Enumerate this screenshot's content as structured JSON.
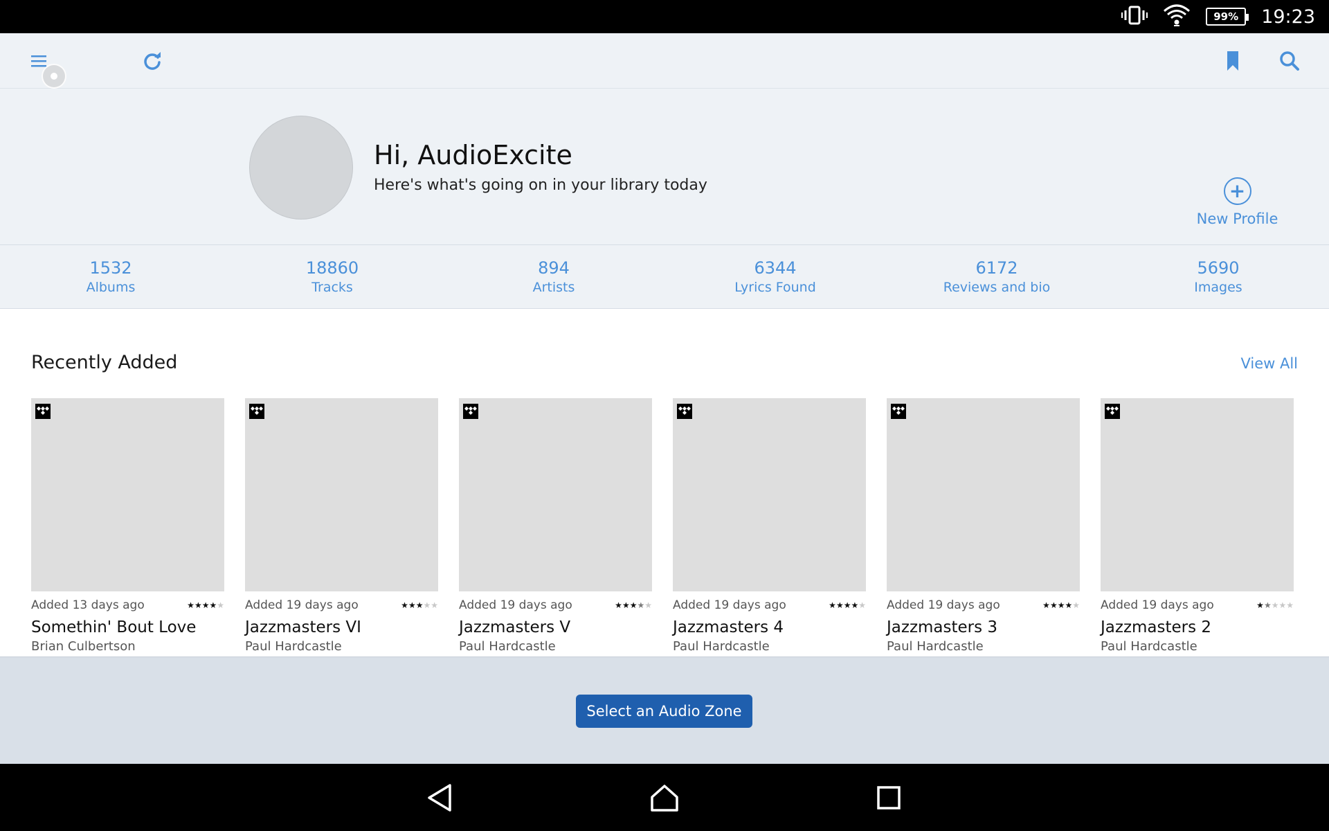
{
  "status_bar": {
    "battery": "99%",
    "time": "19:23"
  },
  "toolbar": {
    "icons": [
      "menu-icon",
      "refresh-icon",
      "bookmark-icon",
      "search-icon"
    ]
  },
  "profile": {
    "greeting": "Hi, AudioExcite",
    "subtitle": "Here's what's going on in your library today",
    "new_profile_label": "New Profile",
    "new_profile_icon": "+"
  },
  "stats": [
    {
      "value": "1532",
      "label": "Albums"
    },
    {
      "value": "18860",
      "label": "Tracks"
    },
    {
      "value": "894",
      "label": "Artists"
    },
    {
      "value": "6344",
      "label": "Lyrics Found"
    },
    {
      "value": "6172",
      "label": "Reviews and bio"
    },
    {
      "value": "5690",
      "label": "Images"
    }
  ],
  "recent": {
    "title": "Recently Added",
    "view_all": "View All",
    "albums": [
      {
        "added": "Added 13 days ago",
        "rating": 4,
        "title": "Somethin' Bout Love",
        "artist": "Brian Culbertson"
      },
      {
        "added": "Added 19 days ago",
        "rating": 3,
        "title": "Jazzmasters VI",
        "artist": "Paul Hardcastle"
      },
      {
        "added": "Added 19 days ago",
        "rating": 3.5,
        "title": "Jazzmasters V",
        "artist": "Paul Hardcastle"
      },
      {
        "added": "Added 19 days ago",
        "rating": 4,
        "title": "Jazzmasters 4",
        "artist": "Paul Hardcastle"
      },
      {
        "added": "Added 19 days ago",
        "rating": 4,
        "title": "Jazzmasters 3",
        "artist": "Paul Hardcastle"
      },
      {
        "added": "Added 19 days ago",
        "rating": 1.5,
        "title": "Jazzmasters 2",
        "artist": "Paul Hardcastle"
      }
    ]
  },
  "zone": {
    "button_label": "Select an Audio Zone"
  },
  "colors": {
    "accent": "#4a90d9",
    "button": "#1f5fae",
    "header_bg": "#eef2f6",
    "zone_bg": "#d9e0e8"
  }
}
